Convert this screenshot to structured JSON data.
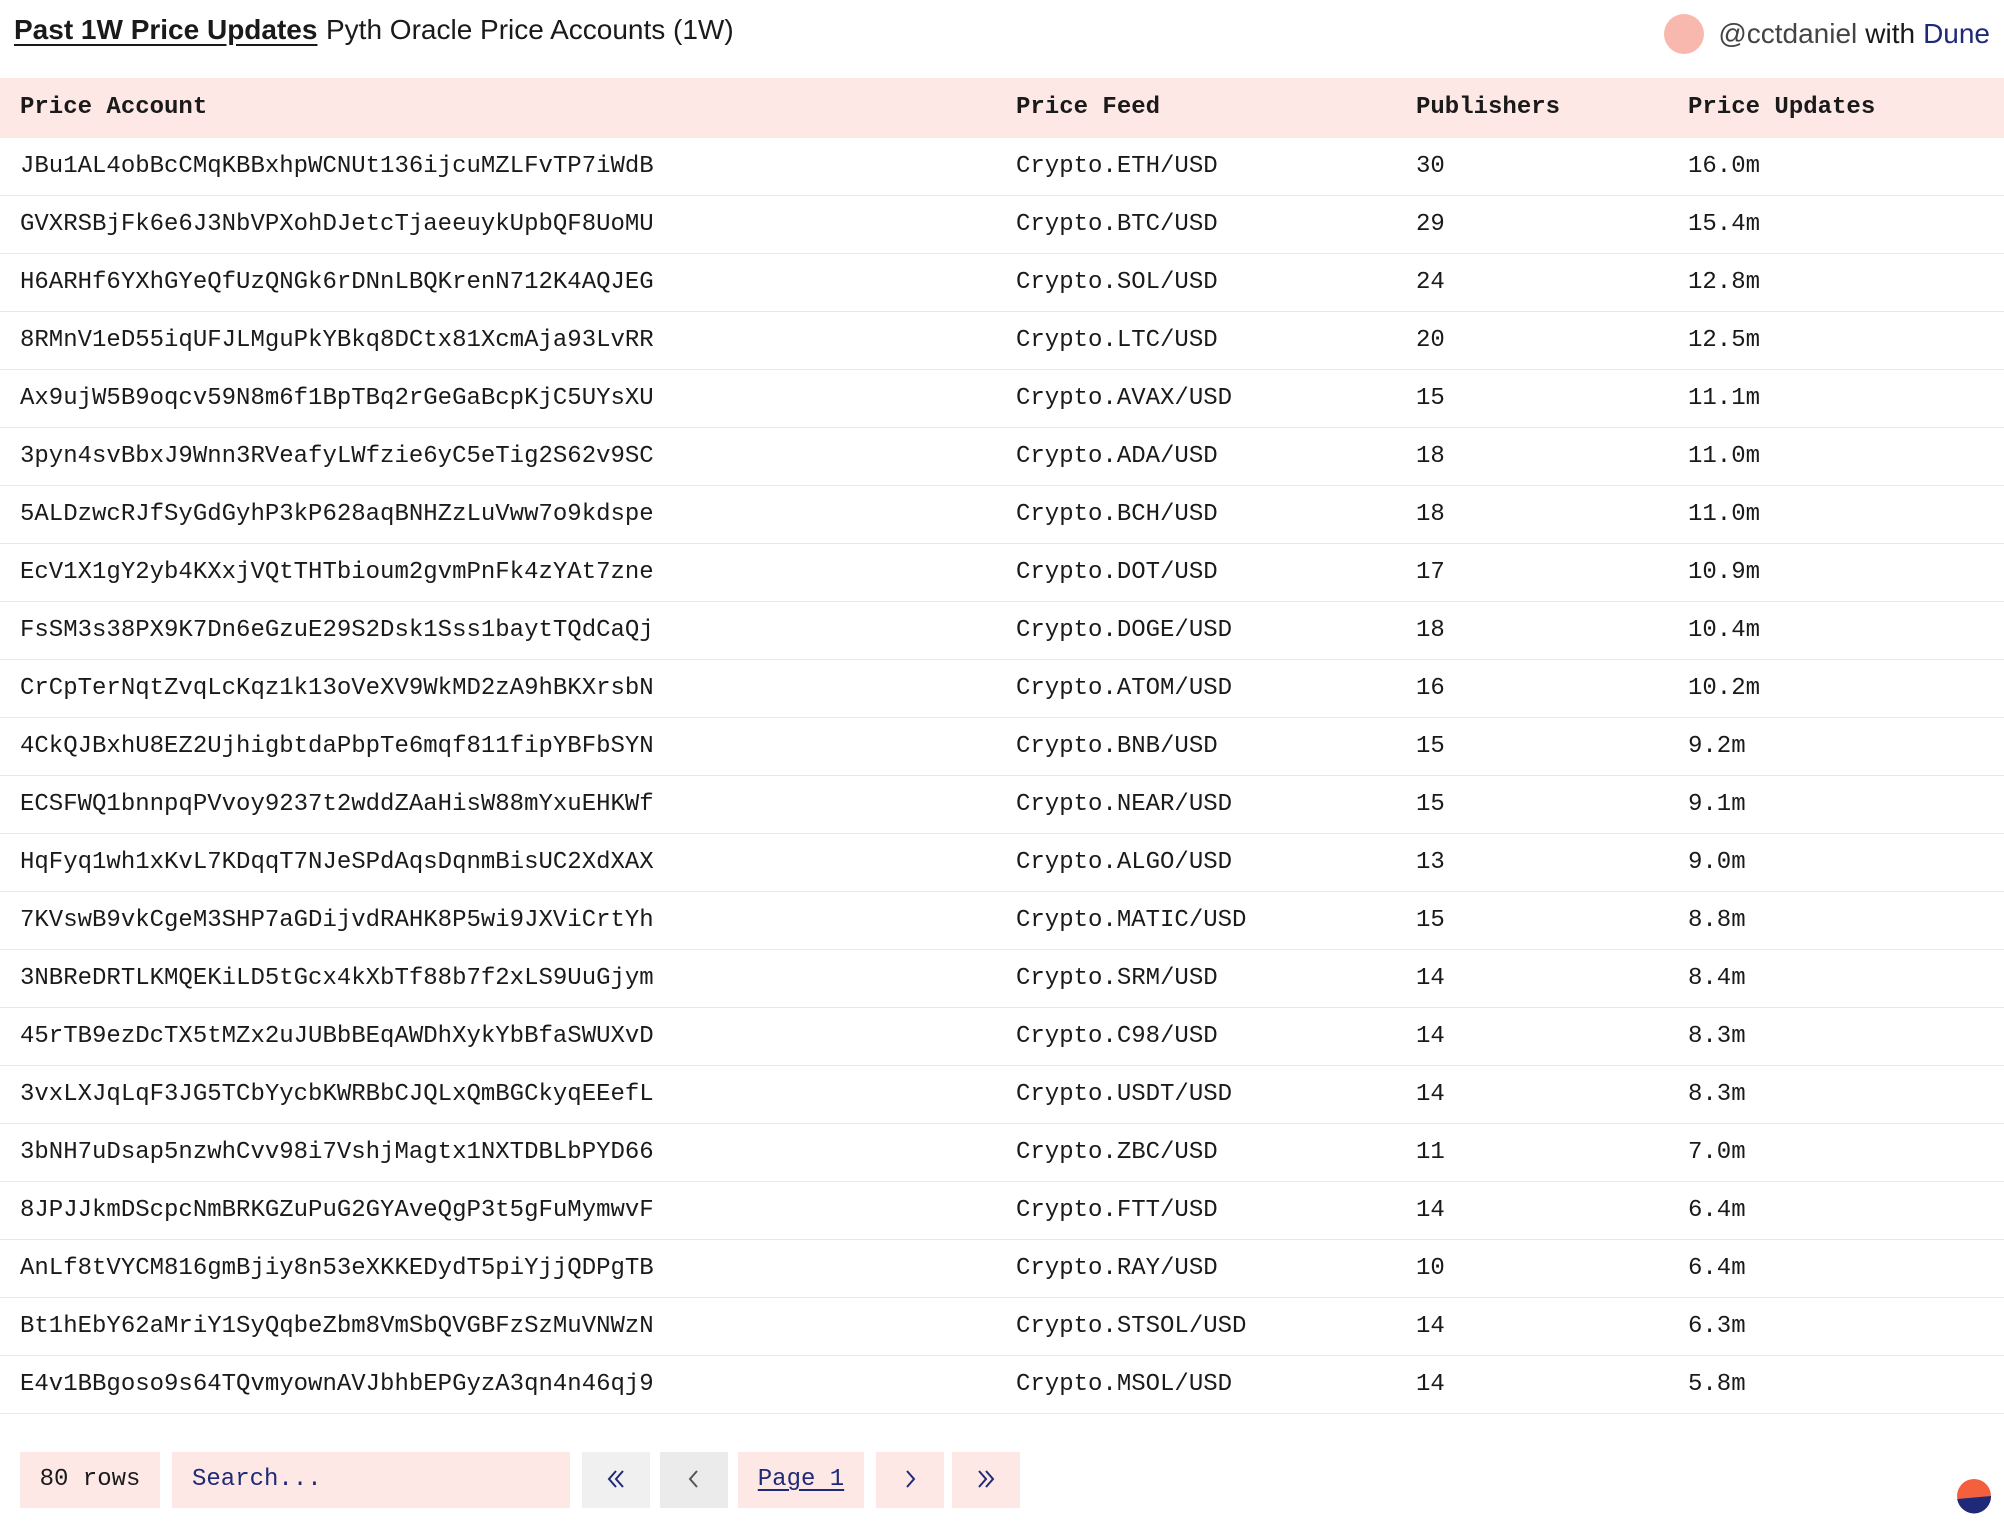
{
  "header": {
    "title": "Past 1W Price Updates",
    "subtitle": "Pyth Oracle Price Accounts (1W)",
    "author": "@cctdaniel",
    "with_text": "with",
    "brand": "Dune",
    "avatar_color": "#f9b8ae"
  },
  "table": {
    "columns": [
      "Price Account",
      "Price Feed",
      "Publishers",
      "Price Updates"
    ],
    "rows": [
      [
        "JBu1AL4obBcCMqKBBxhpWCNUt136ijcuMZLFvTP7iWdB",
        "Crypto.ETH/USD",
        "30",
        "16.0m"
      ],
      [
        "GVXRSBjFk6e6J3NbVPXohDJetcTjaeeuykUpbQF8UoMU",
        "Crypto.BTC/USD",
        "29",
        "15.4m"
      ],
      [
        "H6ARHf6YXhGYeQfUzQNGk6rDNnLBQKrenN712K4AQJEG",
        "Crypto.SOL/USD",
        "24",
        "12.8m"
      ],
      [
        "8RMnV1eD55iqUFJLMguPkYBkq8DCtx81XcmAja93LvRR",
        "Crypto.LTC/USD",
        "20",
        "12.5m"
      ],
      [
        "Ax9ujW5B9oqcv59N8m6f1BpTBq2rGeGaBcpKjC5UYsXU",
        "Crypto.AVAX/USD",
        "15",
        "11.1m"
      ],
      [
        "3pyn4svBbxJ9Wnn3RVeafyLWfzie6yC5eTig2S62v9SC",
        "Crypto.ADA/USD",
        "18",
        "11.0m"
      ],
      [
        "5ALDzwcRJfSyGdGyhP3kP628aqBNHZzLuVww7o9kdspe",
        "Crypto.BCH/USD",
        "18",
        "11.0m"
      ],
      [
        "EcV1X1gY2yb4KXxjVQtTHTbioum2gvmPnFk4zYAt7zne",
        "Crypto.DOT/USD",
        "17",
        "10.9m"
      ],
      [
        "FsSM3s38PX9K7Dn6eGzuE29S2Dsk1Sss1baytTQdCaQj",
        "Crypto.DOGE/USD",
        "18",
        "10.4m"
      ],
      [
        "CrCpTerNqtZvqLcKqz1k13oVeXV9WkMD2zA9hBKXrsbN",
        "Crypto.ATOM/USD",
        "16",
        "10.2m"
      ],
      [
        "4CkQJBxhU8EZ2UjhigbtdaPbpTe6mqf811fipYBFbSYN",
        "Crypto.BNB/USD",
        "15",
        "9.2m"
      ],
      [
        "ECSFWQ1bnnpqPVvoy9237t2wddZAaHisW88mYxuEHKWf",
        "Crypto.NEAR/USD",
        "15",
        "9.1m"
      ],
      [
        "HqFyq1wh1xKvL7KDqqT7NJeSPdAqsDqnmBisUC2XdXAX",
        "Crypto.ALGO/USD",
        "13",
        "9.0m"
      ],
      [
        "7KVswB9vkCgeM3SHP7aGDijvdRAHK8P5wi9JXViCrtYh",
        "Crypto.MATIC/USD",
        "15",
        "8.8m"
      ],
      [
        "3NBReDRTLKMQEKiLD5tGcx4kXbTf88b7f2xLS9UuGjym",
        "Crypto.SRM/USD",
        "14",
        "8.4m"
      ],
      [
        "45rTB9ezDcTX5tMZx2uJUBbBEqAWDhXykYbBfaSWUXvD",
        "Crypto.C98/USD",
        "14",
        "8.3m"
      ],
      [
        "3vxLXJqLqF3JG5TCbYycbKWRBbCJQLxQmBGCkyqEEefL",
        "Crypto.USDT/USD",
        "14",
        "8.3m"
      ],
      [
        "3bNH7uDsap5nzwhCvv98i7VshjMagtx1NXTDBLbPYD66",
        "Crypto.ZBC/USD",
        "11",
        "7.0m"
      ],
      [
        "8JPJJkmDScpcNmBRKGZuPuG2GYAveQgP3t5gFuMymwvF",
        "Crypto.FTT/USD",
        "14",
        "6.4m"
      ],
      [
        "AnLf8tVYCM816gmBjiy8n53eXKKEDydT5piYjjQDPgTB",
        "Crypto.RAY/USD",
        "10",
        "6.4m"
      ],
      [
        "Bt1hEbY62aMriY1SyQqbeZbm8VmSbQVGBFzSzMuVNWzN",
        "Crypto.STSOL/USD",
        "14",
        "6.3m"
      ],
      [
        "E4v1BBgoso9s64TQvmyownAVJbhbEPGyzA3qn4n46qj9",
        "Crypto.MSOL/USD",
        "14",
        "5.8m"
      ]
    ]
  },
  "footer": {
    "rows_count": "80 rows",
    "search_placeholder": "Search...",
    "search_value": "",
    "page_label": "Page 1",
    "icons": {
      "first": "double-chevron-left-icon",
      "prev": "chevron-left-icon",
      "next": "chevron-right-icon",
      "last": "double-chevron-right-icon",
      "logo": "dune-logo-icon"
    }
  },
  "colors": {
    "header_bg": "#fde8e6",
    "accent": "#1e2a78",
    "logo_orange": "#f4603e",
    "logo_navy": "#1e2a78"
  }
}
